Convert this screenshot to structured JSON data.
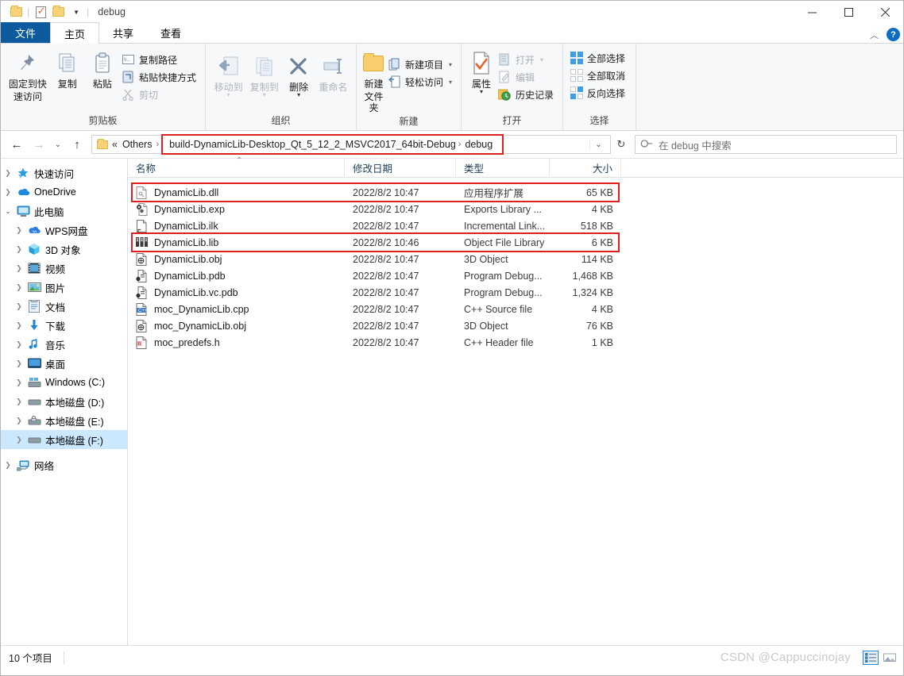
{
  "window": {
    "title": "debug",
    "quick_access": [
      "folder-icon",
      "properties-icon",
      "new-folder-icon",
      "dropdown-caret"
    ],
    "minimize": "—",
    "maximize": "❐",
    "close": "✕",
    "collapse_ribbon": "︿",
    "help": "?"
  },
  "tabs": [
    {
      "label": "文件",
      "kind": "file"
    },
    {
      "label": "主页",
      "kind": "active"
    },
    {
      "label": "共享",
      "kind": "normal"
    },
    {
      "label": "查看",
      "kind": "normal"
    }
  ],
  "ribbon": {
    "groups": [
      {
        "title": "剪贴板",
        "big": [
          {
            "label1": "固定到快",
            "label2": "速访问",
            "icon": "pin-icon",
            "dim": false
          },
          {
            "label1": "复制",
            "label2": "",
            "icon": "copy-icon",
            "dim": false
          },
          {
            "label1": "粘贴",
            "label2": "",
            "icon": "paste-icon",
            "dim": false
          }
        ],
        "small": [
          {
            "label": "复制路径",
            "icon": "copy-path-icon",
            "dim": false
          },
          {
            "label": "粘贴快捷方式",
            "icon": "paste-shortcut-icon",
            "dim": false
          },
          {
            "label": "剪切",
            "icon": "cut-icon",
            "dim": true
          }
        ]
      },
      {
        "title": "组织",
        "big": [
          {
            "label1": "移动到",
            "label2": "",
            "icon": "move-to-icon",
            "dim": true,
            "caret": true
          },
          {
            "label1": "复制到",
            "label2": "",
            "icon": "copy-to-icon",
            "dim": true,
            "caret": true
          },
          {
            "label1": "删除",
            "label2": "",
            "icon": "delete-icon",
            "dim": false,
            "caret": true
          },
          {
            "label1": "重命名",
            "label2": "",
            "icon": "rename-icon",
            "dim": true
          }
        ],
        "small": []
      },
      {
        "title": "新建",
        "big": [
          {
            "label1": "新建",
            "label2": "文件夹",
            "icon": "new-folder-icon",
            "dim": false
          }
        ],
        "small": [
          {
            "label": "新建项目",
            "icon": "new-item-icon",
            "dim": false,
            "caret": true
          },
          {
            "label": "轻松访问",
            "icon": "easy-access-icon",
            "dim": false,
            "caret": true
          }
        ]
      },
      {
        "title": "打开",
        "big": [
          {
            "label1": "属性",
            "label2": "",
            "icon": "properties-icon",
            "dim": false,
            "caret": true
          }
        ],
        "small": [
          {
            "label": "打开",
            "icon": "open-icon",
            "dim": true,
            "caret": true
          },
          {
            "label": "编辑",
            "icon": "edit-icon",
            "dim": true
          },
          {
            "label": "历史记录",
            "icon": "history-icon",
            "dim": false
          }
        ]
      },
      {
        "title": "选择",
        "big": [],
        "small": [
          {
            "label": "全部选择",
            "icon": "select-all-icon",
            "dim": false
          },
          {
            "label": "全部取消",
            "icon": "select-none-icon",
            "dim": false
          },
          {
            "label": "反向选择",
            "icon": "invert-selection-icon",
            "dim": false
          }
        ]
      }
    ]
  },
  "navbar": {
    "back": "←",
    "forward": "→",
    "recent": "⌄",
    "up": "↑",
    "breadcrumbs": [
      {
        "label": "«",
        "type": "overflow"
      },
      {
        "label": "Others",
        "type": "crumb"
      },
      {
        "label": "build-DynamicLib-Desktop_Qt_5_12_2_MSVC2017_64bit-Debug",
        "type": "crumb"
      },
      {
        "label": "debug",
        "type": "crumb"
      }
    ],
    "dropdown": "⌄",
    "refresh": "↻",
    "search_placeholder": "在 debug 中搜索",
    "search_value": "",
    "search_icon": "search-icon"
  },
  "sidebar": {
    "items": [
      {
        "label": "快速访问",
        "icon": "quick-access-star-icon",
        "indent": 0,
        "expanded": false,
        "selected": false
      },
      {
        "label": "OneDrive",
        "icon": "onedrive-cloud-icon",
        "indent": 0,
        "expanded": false,
        "selected": false
      },
      {
        "label": "此电脑",
        "icon": "this-pc-icon",
        "indent": 0,
        "expanded": true,
        "selected": false
      },
      {
        "label": "WPS网盘",
        "icon": "wps-cloud-icon",
        "indent": 1,
        "expanded": false,
        "selected": false
      },
      {
        "label": "3D 对象",
        "icon": "3d-objects-icon",
        "indent": 1,
        "expanded": false,
        "selected": false
      },
      {
        "label": "视频",
        "icon": "videos-icon",
        "indent": 1,
        "expanded": false,
        "selected": false
      },
      {
        "label": "图片",
        "icon": "pictures-icon",
        "indent": 1,
        "expanded": false,
        "selected": false
      },
      {
        "label": "文档",
        "icon": "documents-icon",
        "indent": 1,
        "expanded": false,
        "selected": false
      },
      {
        "label": "下载",
        "icon": "downloads-icon",
        "indent": 1,
        "expanded": false,
        "selected": false
      },
      {
        "label": "音乐",
        "icon": "music-icon",
        "indent": 1,
        "expanded": false,
        "selected": false
      },
      {
        "label": "桌面",
        "icon": "desktop-icon",
        "indent": 1,
        "expanded": false,
        "selected": false
      },
      {
        "label": "Windows (C:)",
        "icon": "windows-drive-icon",
        "indent": 1,
        "expanded": false,
        "selected": false
      },
      {
        "label": "本地磁盘 (D:)",
        "icon": "drive-icon",
        "indent": 1,
        "expanded": false,
        "selected": false
      },
      {
        "label": "本地磁盘 (E:)",
        "icon": "drive-locked-icon",
        "indent": 1,
        "expanded": false,
        "selected": false
      },
      {
        "label": "本地磁盘 (F:)",
        "icon": "drive-icon",
        "indent": 1,
        "expanded": false,
        "selected": true
      },
      {
        "label": "网络",
        "icon": "network-icon",
        "indent": 0,
        "expanded": false,
        "selected": false
      }
    ]
  },
  "filelist": {
    "columns": [
      {
        "label": "名称",
        "key": "name"
      },
      {
        "label": "修改日期",
        "key": "date"
      },
      {
        "label": "类型",
        "key": "type"
      },
      {
        "label": "大小",
        "key": "size"
      }
    ],
    "sort_indicator": "⌃",
    "sort_column": "名称",
    "rows": [
      {
        "name": "DynamicLib.dll",
        "date": "2022/8/2 10:47",
        "type": "应用程序扩展",
        "size": "65 KB",
        "icon": "dll-file-icon",
        "highlight": true
      },
      {
        "name": "DynamicLib.exp",
        "date": "2022/8/2 10:47",
        "type": "Exports Library ...",
        "size": "4 KB",
        "icon": "exp-file-icon",
        "highlight": false
      },
      {
        "name": "DynamicLib.ilk",
        "date": "2022/8/2 10:47",
        "type": "Incremental Link...",
        "size": "518 KB",
        "icon": "ilk-file-icon",
        "highlight": false
      },
      {
        "name": "DynamicLib.lib",
        "date": "2022/8/2 10:46",
        "type": "Object File Library",
        "size": "6 KB",
        "icon": "lib-file-icon",
        "highlight": true
      },
      {
        "name": "DynamicLib.obj",
        "date": "2022/8/2 10:47",
        "type": "3D Object",
        "size": "114 KB",
        "icon": "obj-file-icon",
        "highlight": false
      },
      {
        "name": "DynamicLib.pdb",
        "date": "2022/8/2 10:47",
        "type": "Program Debug...",
        "size": "1,468 KB",
        "icon": "pdb-file-icon",
        "highlight": false
      },
      {
        "name": "DynamicLib.vc.pdb",
        "date": "2022/8/2 10:47",
        "type": "Program Debug...",
        "size": "1,324 KB",
        "icon": "pdb-file-icon",
        "highlight": false
      },
      {
        "name": "moc_DynamicLib.cpp",
        "date": "2022/8/2 10:47",
        "type": "C++ Source file",
        "size": "4 KB",
        "icon": "cpp-file-icon",
        "highlight": false
      },
      {
        "name": "moc_DynamicLib.obj",
        "date": "2022/8/2 10:47",
        "type": "3D Object",
        "size": "76 KB",
        "icon": "obj-file-icon",
        "highlight": false
      },
      {
        "name": "moc_predefs.h",
        "date": "2022/8/2 10:47",
        "type": "C++ Header file",
        "size": "1 KB",
        "icon": "header-file-icon",
        "highlight": false
      }
    ]
  },
  "statusbar": {
    "item_count": "10 个项目",
    "view_details_icon": "details-view-icon",
    "view_large_icon": "large-icons-view-icon"
  },
  "watermark": "CSDN @Cappuccinojay",
  "colors": {
    "accent": "#0d5a9e",
    "highlight_red": "#e01f1f",
    "selection_blue": "#cce8ff",
    "ribbon_bg": "#f7f8fa"
  }
}
